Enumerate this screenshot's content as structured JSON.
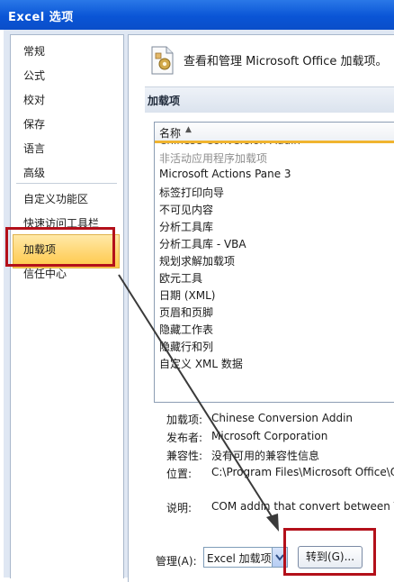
{
  "window": {
    "title": "Excel 选项"
  },
  "sidebar": {
    "items": [
      {
        "label": "常规"
      },
      {
        "label": "公式"
      },
      {
        "label": "校对"
      },
      {
        "label": "保存"
      },
      {
        "label": "语言"
      },
      {
        "label": "高级"
      },
      {
        "label": "自定义功能区"
      },
      {
        "label": "快速访问工具栏"
      },
      {
        "label": "加载项"
      },
      {
        "label": "信任中心"
      }
    ],
    "selected": "加载项"
  },
  "main": {
    "header": "查看和管理 Microsoft Office 加载项。",
    "section_title": "加载项",
    "list": {
      "column_header": "名称",
      "cut_off_row": "Chinese Conversion Addin",
      "group_inactive": "非活动应用程序加载项",
      "items": [
        "Microsoft Actions Pane 3",
        "标签打印向导",
        "不可见内容",
        "分析工具库",
        "分析工具库 - VBA",
        "规划求解加载项",
        "欧元工具",
        "日期 (XML)",
        "页眉和页脚",
        "隐藏工作表",
        "隐藏行和列",
        "自定义 XML 数据"
      ]
    },
    "details": {
      "addin_label": "加载项:",
      "addin_value": "Chinese Conversion Addin",
      "publisher_label": "发布者:",
      "publisher_value": "Microsoft Corporation",
      "compat_label": "兼容性:",
      "compat_value": "没有可用的兼容性信息",
      "location_label": "位置:",
      "location_value": "C:\\Program Files\\Microsoft Office\\O",
      "desc_label": "说明:",
      "desc_value": "COM addin that convert between T"
    },
    "manage": {
      "label": "管理(A):",
      "selected": "Excel 加载项",
      "go_button": "转到(G)..."
    }
  },
  "annotation": {
    "color": "#b3101a"
  }
}
